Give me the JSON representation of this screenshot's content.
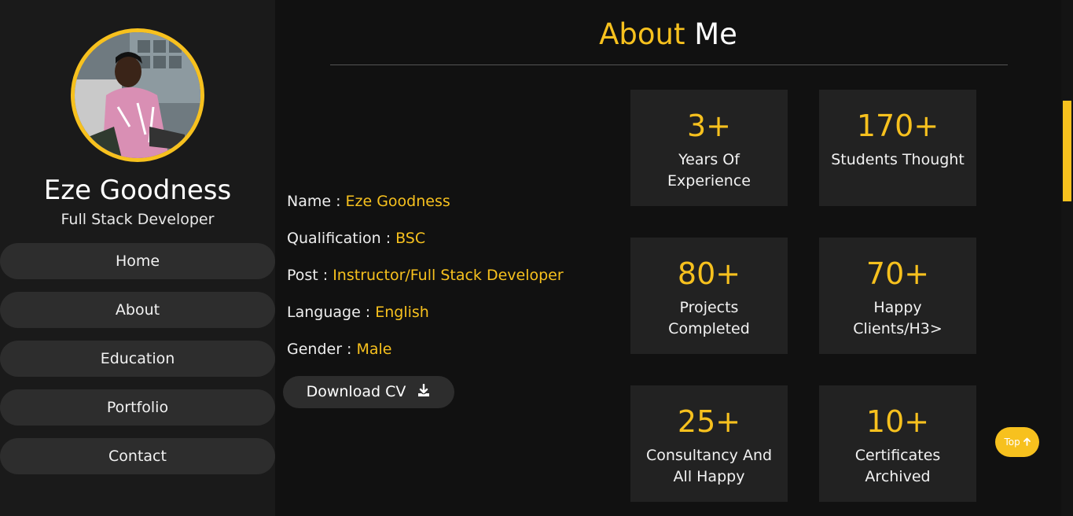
{
  "profile": {
    "name": "Eze Goodness",
    "role": "Full Stack Developer",
    "avatar_icon": "profile-photo"
  },
  "nav": {
    "items": [
      {
        "label": "Home"
      },
      {
        "label": "About"
      },
      {
        "label": "Education"
      },
      {
        "label": "Portfolio"
      },
      {
        "label": "Contact"
      }
    ]
  },
  "about": {
    "title_accent": "About",
    "title_rest": "Me",
    "info": [
      {
        "label": "Name :",
        "value": "Eze Goodness"
      },
      {
        "label": "Qualification :",
        "value": "BSC"
      },
      {
        "label": "Post :",
        "value": "Instructor/Full Stack Developer"
      },
      {
        "label": "Language :",
        "value": "English"
      },
      {
        "label": "Gender :",
        "value": "Male"
      }
    ],
    "cv_button": "Download CV",
    "stats": [
      {
        "value": "3+",
        "label": "Years Of Experience"
      },
      {
        "value": "170+",
        "label": "Students Thought"
      },
      {
        "value": "80+",
        "label": "Projects Completed"
      },
      {
        "value": "70+",
        "label": "Happy Clients/H3>"
      },
      {
        "value": "25+",
        "label": "Consultancy And All Happy"
      },
      {
        "value": "10+",
        "label": "Certificates Archived"
      }
    ]
  },
  "top_button": {
    "label": "Top",
    "icon": "arrow-up-icon"
  },
  "colors": {
    "accent": "#f7c11e",
    "background": "#111111",
    "sidebar": "#1a1a1a",
    "card": "#222222"
  }
}
